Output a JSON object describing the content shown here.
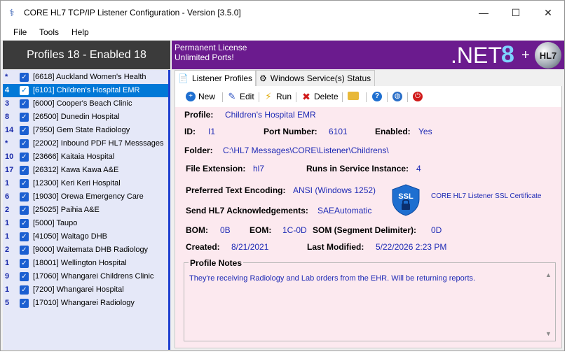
{
  "window": {
    "title": "CORE HL7 TCP/IP Listener Configuration - Version [3.5.0]",
    "minimize_glyph": "—",
    "maximize_glyph": "☐",
    "close_glyph": "✕"
  },
  "menu": {
    "file": "File",
    "tools": "Tools",
    "help": "Help"
  },
  "left_panel": {
    "header": "Profiles 18 - Enabled 18",
    "profiles": [
      {
        "mark": "*",
        "label": "[6618] Auckland Women's Health",
        "checked": true,
        "selected": false
      },
      {
        "mark": "4",
        "label": "[6101] Children's Hospital EMR",
        "checked": true,
        "selected": true
      },
      {
        "mark": "3",
        "label": "[6000] Cooper's Beach Clinic",
        "checked": true,
        "selected": false
      },
      {
        "mark": "8",
        "label": "[26500] Dunedin Hospital",
        "checked": true,
        "selected": false
      },
      {
        "mark": "14",
        "label": "[7950] Gem State Radiology",
        "checked": true,
        "selected": false
      },
      {
        "mark": "*",
        "label": "[22002] Inbound PDF HL7 Messsages",
        "checked": true,
        "selected": false
      },
      {
        "mark": "10",
        "label": "[23666] Kaitaia Hospital",
        "checked": true,
        "selected": false
      },
      {
        "mark": "17",
        "label": "[26312] Kawa Kawa A&E",
        "checked": true,
        "selected": false
      },
      {
        "mark": "1",
        "label": "[12300] Keri Keri Hospital",
        "checked": true,
        "selected": false
      },
      {
        "mark": "6",
        "label": "[19030] Orewa Emergency Care",
        "checked": true,
        "selected": false
      },
      {
        "mark": "2",
        "label": "[25025] Paihia A&E",
        "checked": true,
        "selected": false
      },
      {
        "mark": "1",
        "label": "[5000] Taupo",
        "checked": true,
        "selected": false
      },
      {
        "mark": "1",
        "label": "[41050] Waitago DHB",
        "checked": true,
        "selected": false
      },
      {
        "mark": "2",
        "label": "[9000] Waitemata DHB Radiology",
        "checked": true,
        "selected": false
      },
      {
        "mark": "1",
        "label": "[18001] Wellington Hospital",
        "checked": true,
        "selected": false
      },
      {
        "mark": "9",
        "label": "[17060] Whangarei Childrens Clinic",
        "checked": true,
        "selected": false
      },
      {
        "mark": "1",
        "label": "[7200] Whangarei Hospital",
        "checked": true,
        "selected": false
      },
      {
        "mark": "5",
        "label": "[17010] Whangarei Radiology",
        "checked": true,
        "selected": false
      }
    ]
  },
  "banner": {
    "line1": "Permanent License",
    "line2": "Unlimited Ports!",
    "net_text": ".NET",
    "net_version": "8",
    "plus": "+",
    "logo_text": "HL7"
  },
  "tabs": [
    {
      "label": "Listener Profiles",
      "active": true
    },
    {
      "label": "Windows Service(s) Status",
      "active": false
    }
  ],
  "toolbar": {
    "new": "New",
    "edit": "Edit",
    "run": "Run",
    "delete": "Delete"
  },
  "detail": {
    "profile_label": "Profile:",
    "profile_value": "Children's Hospital EMR",
    "id_label": "ID:",
    "id_value": "I1",
    "port_label": "Port Number:",
    "port_value": "6101",
    "enabled_label": "Enabled:",
    "enabled_value": "Yes",
    "folder_label": "Folder:",
    "folder_value": "C:\\HL7 Messages\\CORE\\Listener\\Childrens\\",
    "ext_label": "File Extension:",
    "ext_value": "hl7",
    "instance_label": "Runs in Service Instance:",
    "instance_value": "4",
    "encoding_label": "Preferred Text Encoding:",
    "encoding_value": "ANSI (Windows 1252)",
    "ack_label": "Send HL7 Acknowledgements:",
    "ack_value": "SAEAutomatic",
    "ssl_badge": "SSL",
    "ssl_text": "CORE HL7 Listener SSL Certificate",
    "bom_label": "BOM:",
    "bom_value": "0B",
    "eom_label": "EOM:",
    "eom_value": "1C-0D",
    "som_label": "SOM (Segment Delimiter):",
    "som_value": "0D",
    "created_label": "Created:",
    "created_value": "8/21/2021",
    "modified_label": "Last Modified:",
    "modified_value": "5/22/2026 2:23 PM",
    "notes_label": "Profile Notes",
    "notes_text": "They're receiving Radiology and Lab orders from the EHR. Will be returning reports."
  },
  "colors": {
    "banner": "#6b1b8e",
    "selection": "#0078d7",
    "value_text": "#1f2bb5",
    "detail_bg": "#fce9ef",
    "list_bg": "#e5e8f8"
  }
}
